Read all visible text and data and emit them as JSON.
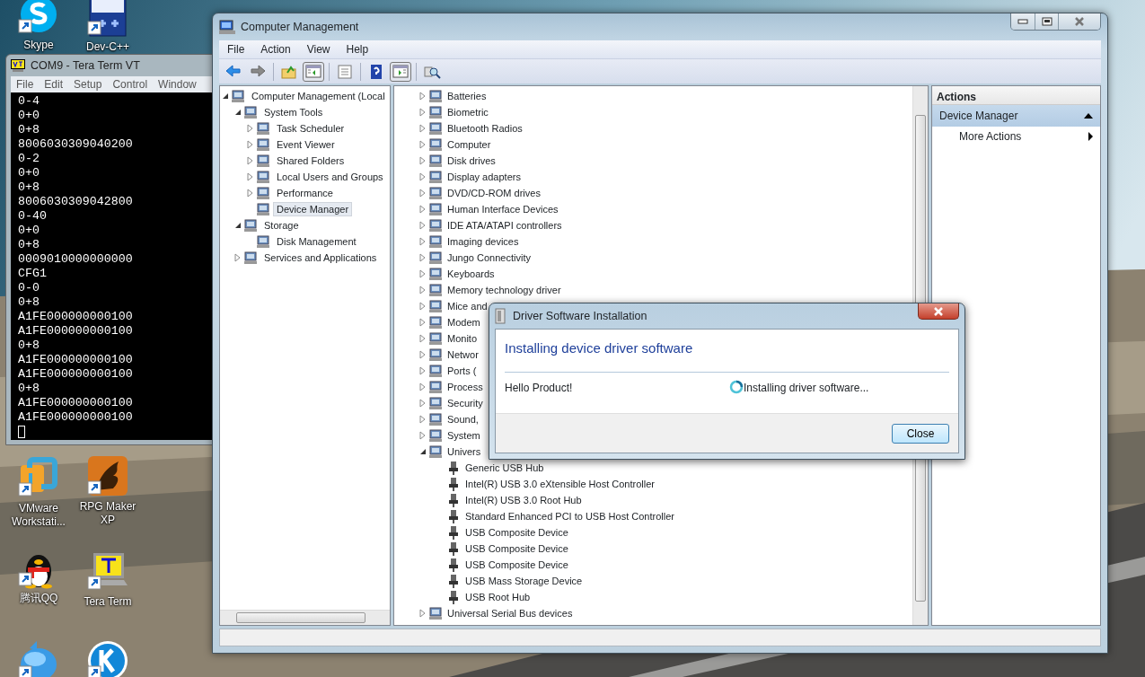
{
  "desktop_icons": [
    {
      "kind": "skype",
      "label": "Skype"
    },
    {
      "kind": "devcpp",
      "label": "Dev-C++"
    },
    {
      "kind": "vmware",
      "label": "VMware Workstati..."
    },
    {
      "kind": "rpgmaker",
      "label": "RPG Maker XP"
    },
    {
      "kind": "qq",
      "label": "腾讯QQ"
    },
    {
      "kind": "teraterm",
      "label": "Tera Term"
    },
    {
      "kind": "bubble"
    },
    {
      "kind": "k"
    }
  ],
  "tera_term": {
    "title": "COM9 - Tera Term VT",
    "menu": [
      "File",
      "Edit",
      "Setup",
      "Control",
      "Window"
    ],
    "lines": [
      "0-4",
      "0+0",
      "0+8",
      "8006030309040200",
      "0-2",
      "0+0",
      "0+8",
      "8006030309042800",
      "0-40",
      "0+0",
      "0+8",
      "0009010000000000",
      "CFG1",
      "0-0",
      "0+8",
      "A1FE000000000100",
      "A1FE000000000100",
      "0+8",
      "A1FE000000000100",
      "A1FE000000000100",
      "0+8",
      "A1FE000000000100",
      "A1FE000000000100"
    ]
  },
  "computer_management": {
    "title": "Computer Management",
    "menu": [
      "File",
      "Action",
      "View",
      "Help"
    ],
    "toolbar": [
      {
        "kind": "back",
        "pressed": false
      },
      {
        "kind": "forward",
        "pressed": false
      },
      {
        "kind": "separator"
      },
      {
        "kind": "up",
        "pressed": false
      },
      {
        "kind": "console_tree",
        "pressed": true
      },
      {
        "kind": "separator"
      },
      {
        "kind": "properties",
        "pressed": false
      },
      {
        "kind": "separator"
      },
      {
        "kind": "help",
        "pressed": false
      },
      {
        "kind": "action_pane",
        "pressed": true
      },
      {
        "kind": "separator"
      },
      {
        "kind": "scan",
        "pressed": false
      }
    ],
    "tree": [
      {
        "label": "Computer Management (Local",
        "expanded": true,
        "selected": false,
        "children": [
          {
            "label": "System Tools",
            "expanded": true,
            "selected": false,
            "children": [
              {
                "label": "Task Scheduler",
                "expanded": false,
                "selected": false
              },
              {
                "label": "Event Viewer",
                "expanded": false,
                "selected": false
              },
              {
                "label": "Shared Folders",
                "expanded": false,
                "selected": false
              },
              {
                "label": "Local Users and Groups",
                "expanded": false,
                "selected": false
              },
              {
                "label": "Performance",
                "expanded": false,
                "selected": false
              },
              {
                "label": "Device Manager",
                "selected": true
              }
            ]
          },
          {
            "label": "Storage",
            "expanded": true,
            "selected": false,
            "children": [
              {
                "label": "Disk Management",
                "selected": false
              }
            ]
          },
          {
            "label": "Services and Applications",
            "expanded": false,
            "selected": false
          }
        ]
      }
    ],
    "devices": [
      {
        "label": "Batteries",
        "expanded": false
      },
      {
        "label": "Biometric",
        "expanded": false
      },
      {
        "label": "Bluetooth Radios",
        "expanded": false
      },
      {
        "label": "Computer",
        "expanded": false
      },
      {
        "label": "Disk drives",
        "expanded": false
      },
      {
        "label": "Display adapters",
        "expanded": false
      },
      {
        "label": "DVD/CD-ROM drives",
        "expanded": false
      },
      {
        "label": "Human Interface Devices",
        "expanded": false
      },
      {
        "label": "IDE ATA/ATAPI controllers",
        "expanded": false
      },
      {
        "label": "Imaging devices",
        "expanded": false
      },
      {
        "label": "Jungo Connectivity",
        "expanded": false
      },
      {
        "label": "Keyboards",
        "expanded": false
      },
      {
        "label": "Memory technology driver",
        "expanded": false
      },
      {
        "label": "Mice and",
        "expanded": false
      },
      {
        "label": "Modem",
        "expanded": false
      },
      {
        "label": "Monito",
        "expanded": false
      },
      {
        "label": "Networ",
        "expanded": false
      },
      {
        "label": "Ports (",
        "expanded": false
      },
      {
        "label": "Process",
        "expanded": false
      },
      {
        "label": "Security",
        "expanded": false
      },
      {
        "label": "Sound,",
        "expanded": false
      },
      {
        "label": "System",
        "expanded": false
      },
      {
        "label": "Univers",
        "expanded": true,
        "children": [
          {
            "label": "Generic USB Hub"
          },
          {
            "label": "Intel(R) USB 3.0 eXtensible Host Controller"
          },
          {
            "label": "Intel(R) USB 3.0 Root Hub"
          },
          {
            "label": "Standard Enhanced PCI to USB Host Controller"
          },
          {
            "label": "USB Composite Device"
          },
          {
            "label": "USB Composite Device"
          },
          {
            "label": "USB Composite Device"
          },
          {
            "label": "USB Mass Storage Device"
          },
          {
            "label": "USB Root Hub"
          }
        ]
      },
      {
        "label": "Universal Serial Bus devices",
        "expanded": false
      }
    ],
    "actions": {
      "title": "Actions",
      "items": [
        {
          "label": "Device Manager",
          "kind": "section",
          "expanded": true
        },
        {
          "label": "More Actions",
          "kind": "submenu"
        }
      ]
    }
  },
  "dialog": {
    "title": "Driver Software Installation",
    "heading": "Installing device driver software",
    "device": "Hello Product!",
    "status": "Installing driver software...",
    "button": "Close"
  }
}
